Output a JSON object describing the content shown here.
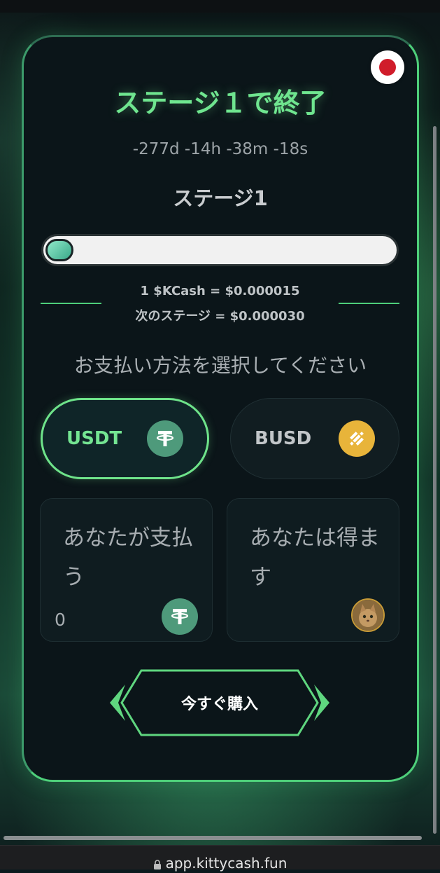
{
  "presale": {
    "title": "ステージ１で終了",
    "countdown": "-277d -14h -38m -18s",
    "stage_label": "ステージ1",
    "progress_fraction": 0.0,
    "rate_line": "1 $KCash = $0.000015",
    "next_stage_line": "次のステージ = $0.000030"
  },
  "payment": {
    "prompt": "お支払い方法を選択してください",
    "options": [
      {
        "label": "USDT",
        "icon": "tether-icon",
        "selected": true
      },
      {
        "label": "BUSD",
        "icon": "binance-icon",
        "selected": false
      }
    ]
  },
  "pay_box": {
    "label": "あなたが支払う",
    "value": "0",
    "icon": "tether-icon"
  },
  "receive_box": {
    "label": "あなたは得ます",
    "icon": "kittycash-cat-icon"
  },
  "buy_button": {
    "label": "今すぐ購入"
  },
  "browser": {
    "url": "app.kittycash.fun"
  },
  "language_flag": "japan-flag-icon",
  "colors": {
    "accent_green": "#6fe58f",
    "card_bg": "#0b1519",
    "tether_green": "#4e9a7b",
    "binance_yellow": "#e8b43a",
    "flag_red": "#d01c2a"
  }
}
